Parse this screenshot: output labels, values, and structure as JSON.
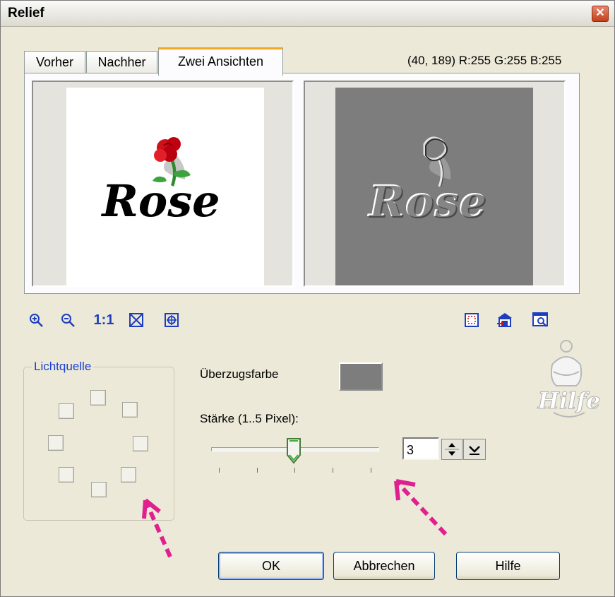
{
  "window": {
    "title": "Relief",
    "close_glyph": "✕"
  },
  "tabs": [
    {
      "label": "Vorher",
      "active": false
    },
    {
      "label": "Nachher",
      "active": false
    },
    {
      "label": "Zwei Ansichten",
      "active": true
    }
  ],
  "pixel_info": "(40, 189) R:255 G:255 B:255",
  "preview": {
    "before_text": "Rose",
    "after_text": "Rose",
    "effect_color": "#7d7d7d"
  },
  "toolbar": {
    "zoom_in_icon": "zoom-in-icon",
    "zoom_out_icon": "zoom-out-icon",
    "actual_size_label": "1:1",
    "fit_icon": "fit-window-icon",
    "pan_icon": "pan-icon",
    "right_icons": [
      "selection-icon",
      "store-icon",
      "preview-icon"
    ]
  },
  "light_source": {
    "label": "Lichtquelle",
    "directions": [
      "n",
      "ne",
      "e",
      "se",
      "s",
      "sw",
      "w",
      "nw"
    ]
  },
  "coating_color": {
    "label": "Überzugsfarbe",
    "color": "#7d7d7d"
  },
  "strength": {
    "label": "Stärke (1..5 Pixel):",
    "value": "3",
    "min": 1,
    "max": 5,
    "slider_value": 3
  },
  "help_image_text": "Hilfe",
  "buttons": {
    "ok": "OK",
    "cancel": "Abbrechen",
    "help": "Hilfe"
  },
  "annotation_color": "#e0208f"
}
